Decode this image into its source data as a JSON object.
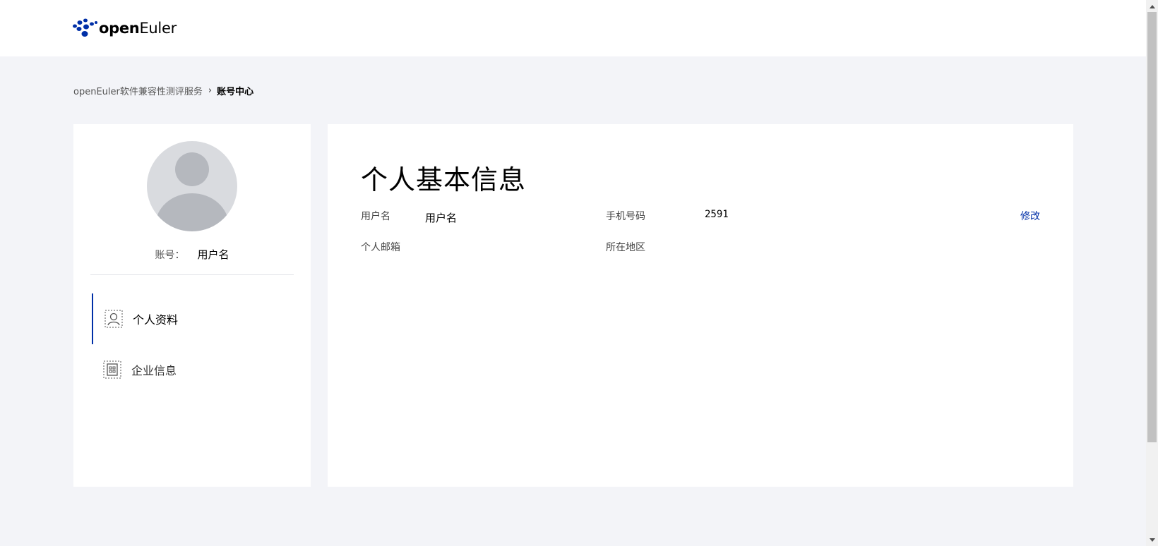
{
  "header": {
    "logo_text_bold": "open",
    "logo_text_rest": "Euler"
  },
  "breadcrumb": {
    "root": "openEuler软件兼容性测评服务",
    "separator": "›",
    "current": "账号中心"
  },
  "profile": {
    "account_label": "账号：",
    "account_value": "用户名"
  },
  "menu": [
    {
      "label": "个人资料",
      "icon": "user-icon",
      "active": true
    },
    {
      "label": "企业信息",
      "icon": "building-icon",
      "active": false
    }
  ],
  "main": {
    "title": "个人基本信息",
    "fields": {
      "username_label": "用户名",
      "username_value": "用户名",
      "phone_label": "手机号码",
      "phone_value": "2591",
      "email_label": "个人邮箱",
      "email_value": "",
      "region_label": "所在地区",
      "region_value": ""
    },
    "edit_label": "修改"
  },
  "colors": {
    "brand": "#002fa7",
    "page_bg": "#f3f4f8",
    "card_bg": "#ffffff"
  }
}
